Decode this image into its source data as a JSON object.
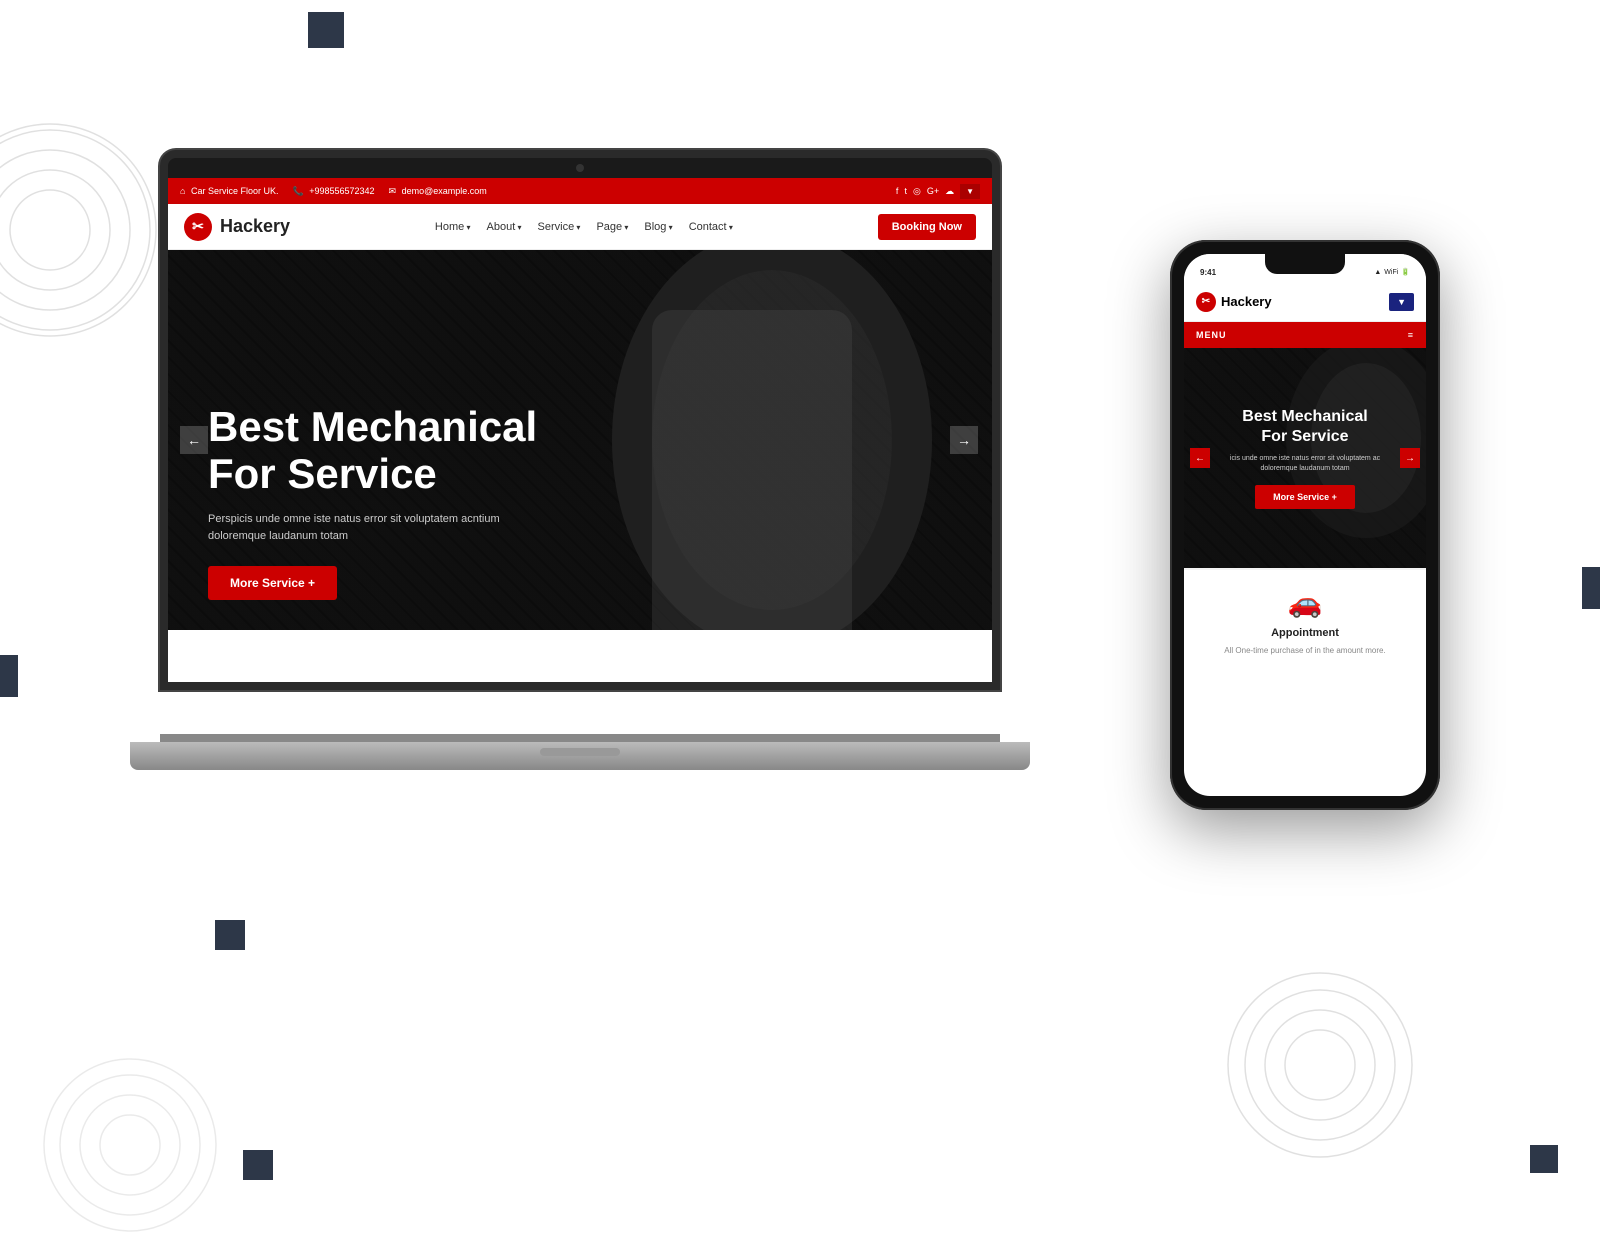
{
  "background": {
    "color": "#ffffff"
  },
  "laptop": {
    "topbar": {
      "address": "Car Service Floor UK.",
      "phone": "+998556572342",
      "email": "demo@example.com",
      "social_icons": [
        "facebook",
        "twitter",
        "instagram",
        "google-plus",
        "other"
      ]
    },
    "navbar": {
      "logo_text": "Hackery",
      "links": [
        "Home",
        "About",
        "Service",
        "Page",
        "Blog",
        "Contact"
      ],
      "booking_btn": "Booking Now"
    },
    "hero": {
      "title_line1": "Best Mechanical",
      "title_line2": "For Service",
      "description": "Perspicis unde omne iste natus error sit voluptatem acntium\ndoloremque laudanum totam",
      "cta_button": "More Service +",
      "arrow_left": "←",
      "arrow_right": "→"
    }
  },
  "phone": {
    "navbar": {
      "logo_text": "Hackery",
      "dropdown_label": "▼"
    },
    "menu": {
      "label": "MENU",
      "icon": "≡"
    },
    "hero": {
      "title_line1": "Best Mechanical",
      "title_line2": "For Service",
      "description": "icis unde omne iste natus error sit voluptatem ac\ndoloremque laudanum totam",
      "cta_button": "More Service +",
      "arrow_left": "←",
      "arrow_right": "→"
    },
    "service": {
      "icon": "🚗",
      "title": "Appointment",
      "description": "All One-time purchase of in the amount more."
    }
  }
}
